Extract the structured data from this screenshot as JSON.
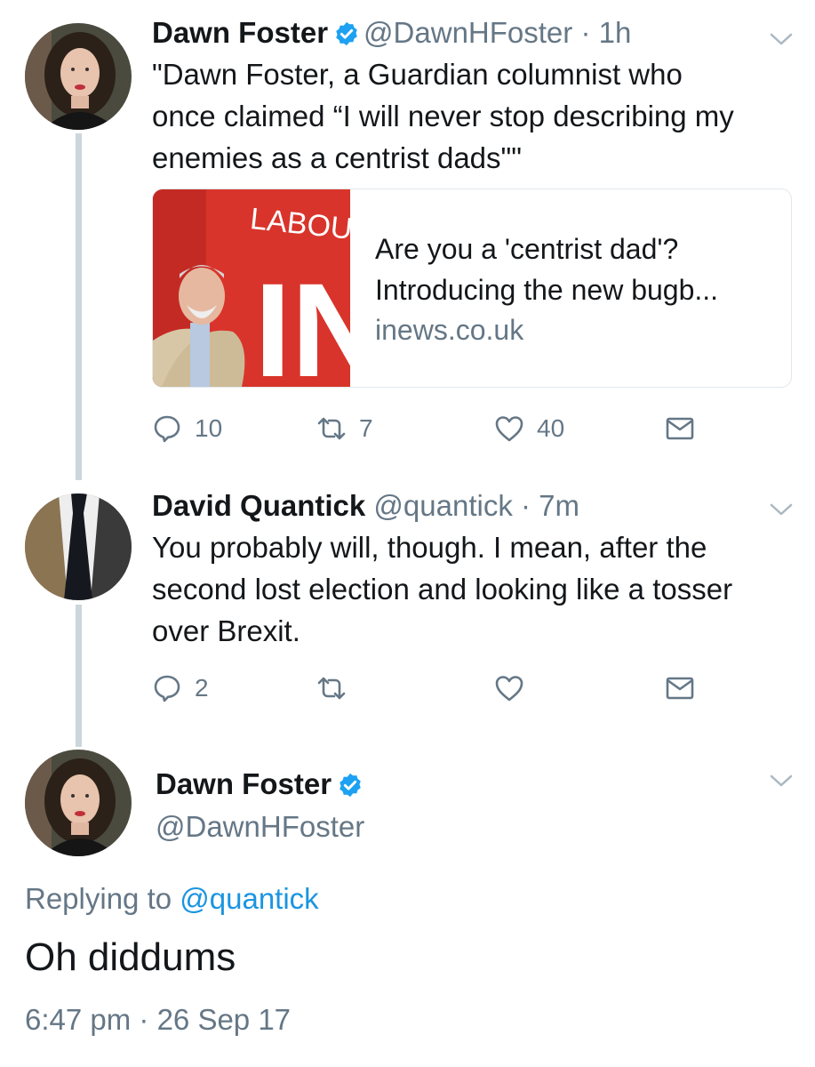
{
  "colors": {
    "link": "#1b95e0",
    "secondary": "#657786",
    "thread_line": "#ccd6dd",
    "verified": "#1da1f2"
  },
  "tweet1": {
    "name": "Dawn Foster",
    "verified": true,
    "handle": "@DawnHFoster",
    "separator": "·",
    "time": "1h",
    "text_lines": [
      "\"Dawn Foster, a Guardian columnist who",
      "once claimed “I will never stop describing my",
      "enemies as a centrist dads\"\""
    ],
    "card": {
      "image_text": "LABOUR IN",
      "title_lines": [
        "Are you a 'centrist dad'?",
        "Introducing the new bugb..."
      ],
      "domain": "inews.co.uk"
    },
    "actions": {
      "replies": "10",
      "retweets": "7",
      "likes": "40"
    }
  },
  "tweet2": {
    "name": "David Quantick",
    "handle": "@quantick",
    "separator": "·",
    "time": "7m",
    "text_lines": [
      "You probably will, though. I mean, after the",
      "second lost election and looking like a tosser",
      "over Brexit."
    ],
    "actions": {
      "replies": "2",
      "retweets": "",
      "likes": ""
    }
  },
  "main_tweet": {
    "name": "Dawn Foster",
    "verified": true,
    "handle": "@DawnHFoster",
    "replying_prefix": "Replying to ",
    "replying_to": "@quantick",
    "text": "Oh diddums",
    "timestamp": "6:47 pm · 26 Sep 17"
  },
  "icons": {
    "reply": "reply-icon",
    "retweet": "retweet-icon",
    "like": "heart-icon",
    "dm": "envelope-icon",
    "more": "chevron-down-icon",
    "verified": "verified-badge-icon"
  }
}
